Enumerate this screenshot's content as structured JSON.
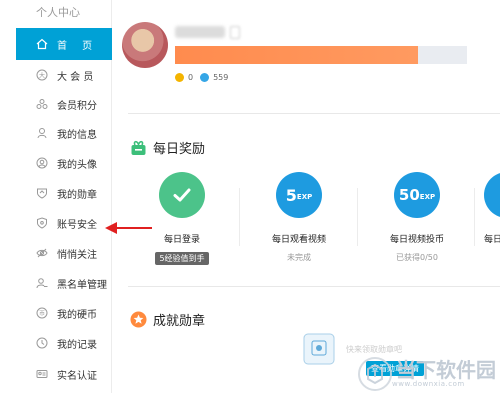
{
  "sidebar": {
    "title": "个人中心",
    "items": [
      {
        "label": "首 页",
        "icon": "home-icon",
        "active": true
      },
      {
        "label": "大 会 员",
        "icon": "vip-icon"
      },
      {
        "label": "会员积分",
        "icon": "points-icon"
      },
      {
        "label": "我的信息",
        "icon": "user-info-icon"
      },
      {
        "label": "我的头像",
        "icon": "avatar-icon"
      },
      {
        "label": "我的勋章",
        "icon": "medal-icon"
      },
      {
        "label": "账号安全",
        "icon": "shield-icon"
      },
      {
        "label": "悄悄关注",
        "icon": "eye-icon"
      },
      {
        "label": "黑名单管理",
        "icon": "blacklist-icon"
      },
      {
        "label": "我的硬币",
        "icon": "coin-icon"
      },
      {
        "label": "我的记录",
        "icon": "record-icon"
      },
      {
        "label": "实名认证",
        "icon": "id-card-icon"
      }
    ]
  },
  "profile": {
    "coin_count": "0",
    "b_coin_count": "559"
  },
  "daily_rewards": {
    "title": "每日奖励",
    "items": [
      {
        "name": "每日登录",
        "status": "5经验值到手",
        "status_style": "tag",
        "color": "#4cc38a"
      },
      {
        "name": "每日观看视频",
        "status": "未完成",
        "exp": "5",
        "color": "#1e9be0"
      },
      {
        "name": "每日视频投币",
        "status": "已获得0/50",
        "exp": "50",
        "color": "#1e9be0"
      },
      {
        "name": "每日",
        "status": "",
        "color": "#1e9be0"
      }
    ]
  },
  "achievements": {
    "title": "成就勋章",
    "button_label": "查看勋章详情",
    "hint": "快来领取勋章吧"
  },
  "exp_suffix": "EXP",
  "watermark": {
    "text": "当下软件园",
    "url": "www.downxia.com"
  },
  "colors": {
    "accent": "#00a1d6",
    "sign_bar": "#ff8b4e",
    "arrow": "#e02020"
  }
}
